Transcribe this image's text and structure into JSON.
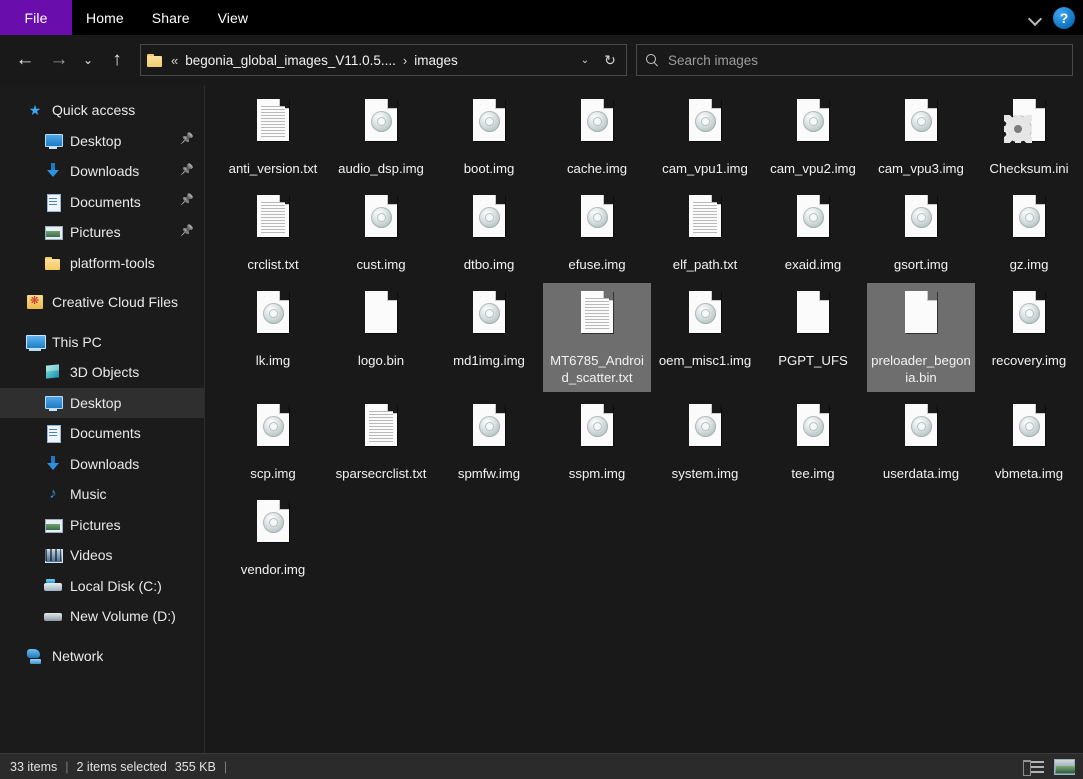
{
  "window": {
    "title": "images",
    "ribbon_tabs": [
      {
        "label": "File",
        "type": "file"
      },
      {
        "label": "Home",
        "type": "normal"
      },
      {
        "label": "Share",
        "type": "normal"
      },
      {
        "label": "View",
        "type": "normal"
      }
    ],
    "ribbon_expand_icon": "chevron-down-icon",
    "help_label": "?",
    "accent_file_tab_color": "#6a0dad",
    "selection_color": "#6e6e6e"
  },
  "nav": {
    "back_glyph": "←",
    "forward_glyph": "→",
    "recent_glyph": "⌄",
    "up_glyph": "↑",
    "address": {
      "overflow_glyph": "«",
      "crumbs": [
        "begonia_global_images_V11.0.5....",
        "images"
      ],
      "separator_glyph": "›",
      "dropdown_glyph": "⌄",
      "refresh_glyph": "↻"
    },
    "search": {
      "placeholder": "Search images",
      "value": "",
      "icon": "search-icon"
    }
  },
  "sidebar": {
    "groups": [
      {
        "items": [
          {
            "label": "Quick access",
            "icon": "star-icon",
            "level": 0,
            "pinned": false,
            "selected": false
          },
          {
            "label": "Desktop",
            "icon": "monitor-icon",
            "level": 1,
            "pinned": true,
            "selected": false
          },
          {
            "label": "Downloads",
            "icon": "download-icon",
            "level": 1,
            "pinned": true,
            "selected": false
          },
          {
            "label": "Documents",
            "icon": "document-icon",
            "level": 1,
            "pinned": true,
            "selected": false
          },
          {
            "label": "Pictures",
            "icon": "pictures-icon",
            "level": 1,
            "pinned": true,
            "selected": false
          },
          {
            "label": "platform-tools",
            "icon": "folder-icon",
            "level": 1,
            "pinned": false,
            "selected": false
          }
        ]
      },
      {
        "items": [
          {
            "label": "Creative Cloud Files",
            "icon": "creative-cloud-icon",
            "level": 0,
            "pinned": false,
            "selected": false
          }
        ]
      },
      {
        "items": [
          {
            "label": "This PC",
            "icon": "this-pc-icon",
            "level": 0,
            "pinned": false,
            "selected": false
          },
          {
            "label": "3D Objects",
            "icon": "3d-objects-icon",
            "level": 1,
            "pinned": false,
            "selected": false
          },
          {
            "label": "Desktop",
            "icon": "monitor-icon",
            "level": 1,
            "pinned": false,
            "selected": true
          },
          {
            "label": "Documents",
            "icon": "document-icon",
            "level": 1,
            "pinned": false,
            "selected": false
          },
          {
            "label": "Downloads",
            "icon": "download-icon",
            "level": 1,
            "pinned": false,
            "selected": false
          },
          {
            "label": "Music",
            "icon": "music-icon",
            "level": 1,
            "pinned": false,
            "selected": false
          },
          {
            "label": "Pictures",
            "icon": "pictures-icon",
            "level": 1,
            "pinned": false,
            "selected": false
          },
          {
            "label": "Videos",
            "icon": "videos-icon",
            "level": 1,
            "pinned": false,
            "selected": false
          },
          {
            "label": "Local Disk (C:)",
            "icon": "drive-icon",
            "level": 1,
            "pinned": false,
            "selected": false
          },
          {
            "label": "New Volume (D:)",
            "icon": "drive-plain-icon",
            "level": 1,
            "pinned": false,
            "selected": false
          }
        ]
      },
      {
        "items": [
          {
            "label": "Network",
            "icon": "network-icon",
            "level": 0,
            "pinned": false,
            "selected": false
          }
        ]
      }
    ]
  },
  "files": [
    {
      "name": "anti_version.txt",
      "icon": "text-file-icon",
      "selected": false
    },
    {
      "name": "audio_dsp.img",
      "icon": "disc-image-icon",
      "selected": false
    },
    {
      "name": "boot.img",
      "icon": "disc-image-icon",
      "selected": false
    },
    {
      "name": "cache.img",
      "icon": "disc-image-icon",
      "selected": false
    },
    {
      "name": "cam_vpu1.img",
      "icon": "disc-image-icon",
      "selected": false
    },
    {
      "name": "cam_vpu2.img",
      "icon": "disc-image-icon",
      "selected": false
    },
    {
      "name": "cam_vpu3.img",
      "icon": "disc-image-icon",
      "selected": false
    },
    {
      "name": "Checksum.ini",
      "icon": "ini-config-icon",
      "selected": false
    },
    {
      "name": "crclist.txt",
      "icon": "text-file-icon",
      "selected": false
    },
    {
      "name": "cust.img",
      "icon": "disc-image-icon",
      "selected": false
    },
    {
      "name": "dtbo.img",
      "icon": "disc-image-icon",
      "selected": false
    },
    {
      "name": "efuse.img",
      "icon": "disc-image-icon",
      "selected": false
    },
    {
      "name": "elf_path.txt",
      "icon": "text-file-icon",
      "selected": false
    },
    {
      "name": "exaid.img",
      "icon": "disc-image-icon",
      "selected": false
    },
    {
      "name": "gsort.img",
      "icon": "disc-image-icon",
      "selected": false
    },
    {
      "name": "gz.img",
      "icon": "disc-image-icon",
      "selected": false
    },
    {
      "name": "lk.img",
      "icon": "disc-image-icon",
      "selected": false
    },
    {
      "name": "logo.bin",
      "icon": "blank-file-icon",
      "selected": false
    },
    {
      "name": "md1img.img",
      "icon": "disc-image-icon",
      "selected": false
    },
    {
      "name": "MT6785_Android_scatter.txt",
      "icon": "text-file-icon",
      "selected": true
    },
    {
      "name": "oem_misc1.img",
      "icon": "disc-image-icon",
      "selected": false
    },
    {
      "name": "PGPT_UFS",
      "icon": "blank-file-icon",
      "selected": false
    },
    {
      "name": "preloader_begonia.bin",
      "icon": "blank-file-icon",
      "selected": true
    },
    {
      "name": "recovery.img",
      "icon": "disc-image-icon",
      "selected": false
    },
    {
      "name": "scp.img",
      "icon": "disc-image-icon",
      "selected": false
    },
    {
      "name": "sparsecrclist.txt",
      "icon": "text-file-icon",
      "selected": false
    },
    {
      "name": "spmfw.img",
      "icon": "disc-image-icon",
      "selected": false
    },
    {
      "name": "sspm.img",
      "icon": "disc-image-icon",
      "selected": false
    },
    {
      "name": "system.img",
      "icon": "disc-image-icon",
      "selected": false
    },
    {
      "name": "tee.img",
      "icon": "disc-image-icon",
      "selected": false
    },
    {
      "name": "userdata.img",
      "icon": "disc-image-icon",
      "selected": false
    },
    {
      "name": "vbmeta.img",
      "icon": "disc-image-icon",
      "selected": false
    },
    {
      "name": "vendor.img",
      "icon": "disc-image-icon",
      "selected": false
    }
  ],
  "status": {
    "item_count": "33 items",
    "divider": "|",
    "selection": "2 items selected",
    "size": "355 KB",
    "trailing_divider": "|",
    "view_buttons": [
      {
        "name": "details-view",
        "label": "Details view"
      },
      {
        "name": "large-icons-view",
        "label": "Large icons view"
      }
    ]
  }
}
